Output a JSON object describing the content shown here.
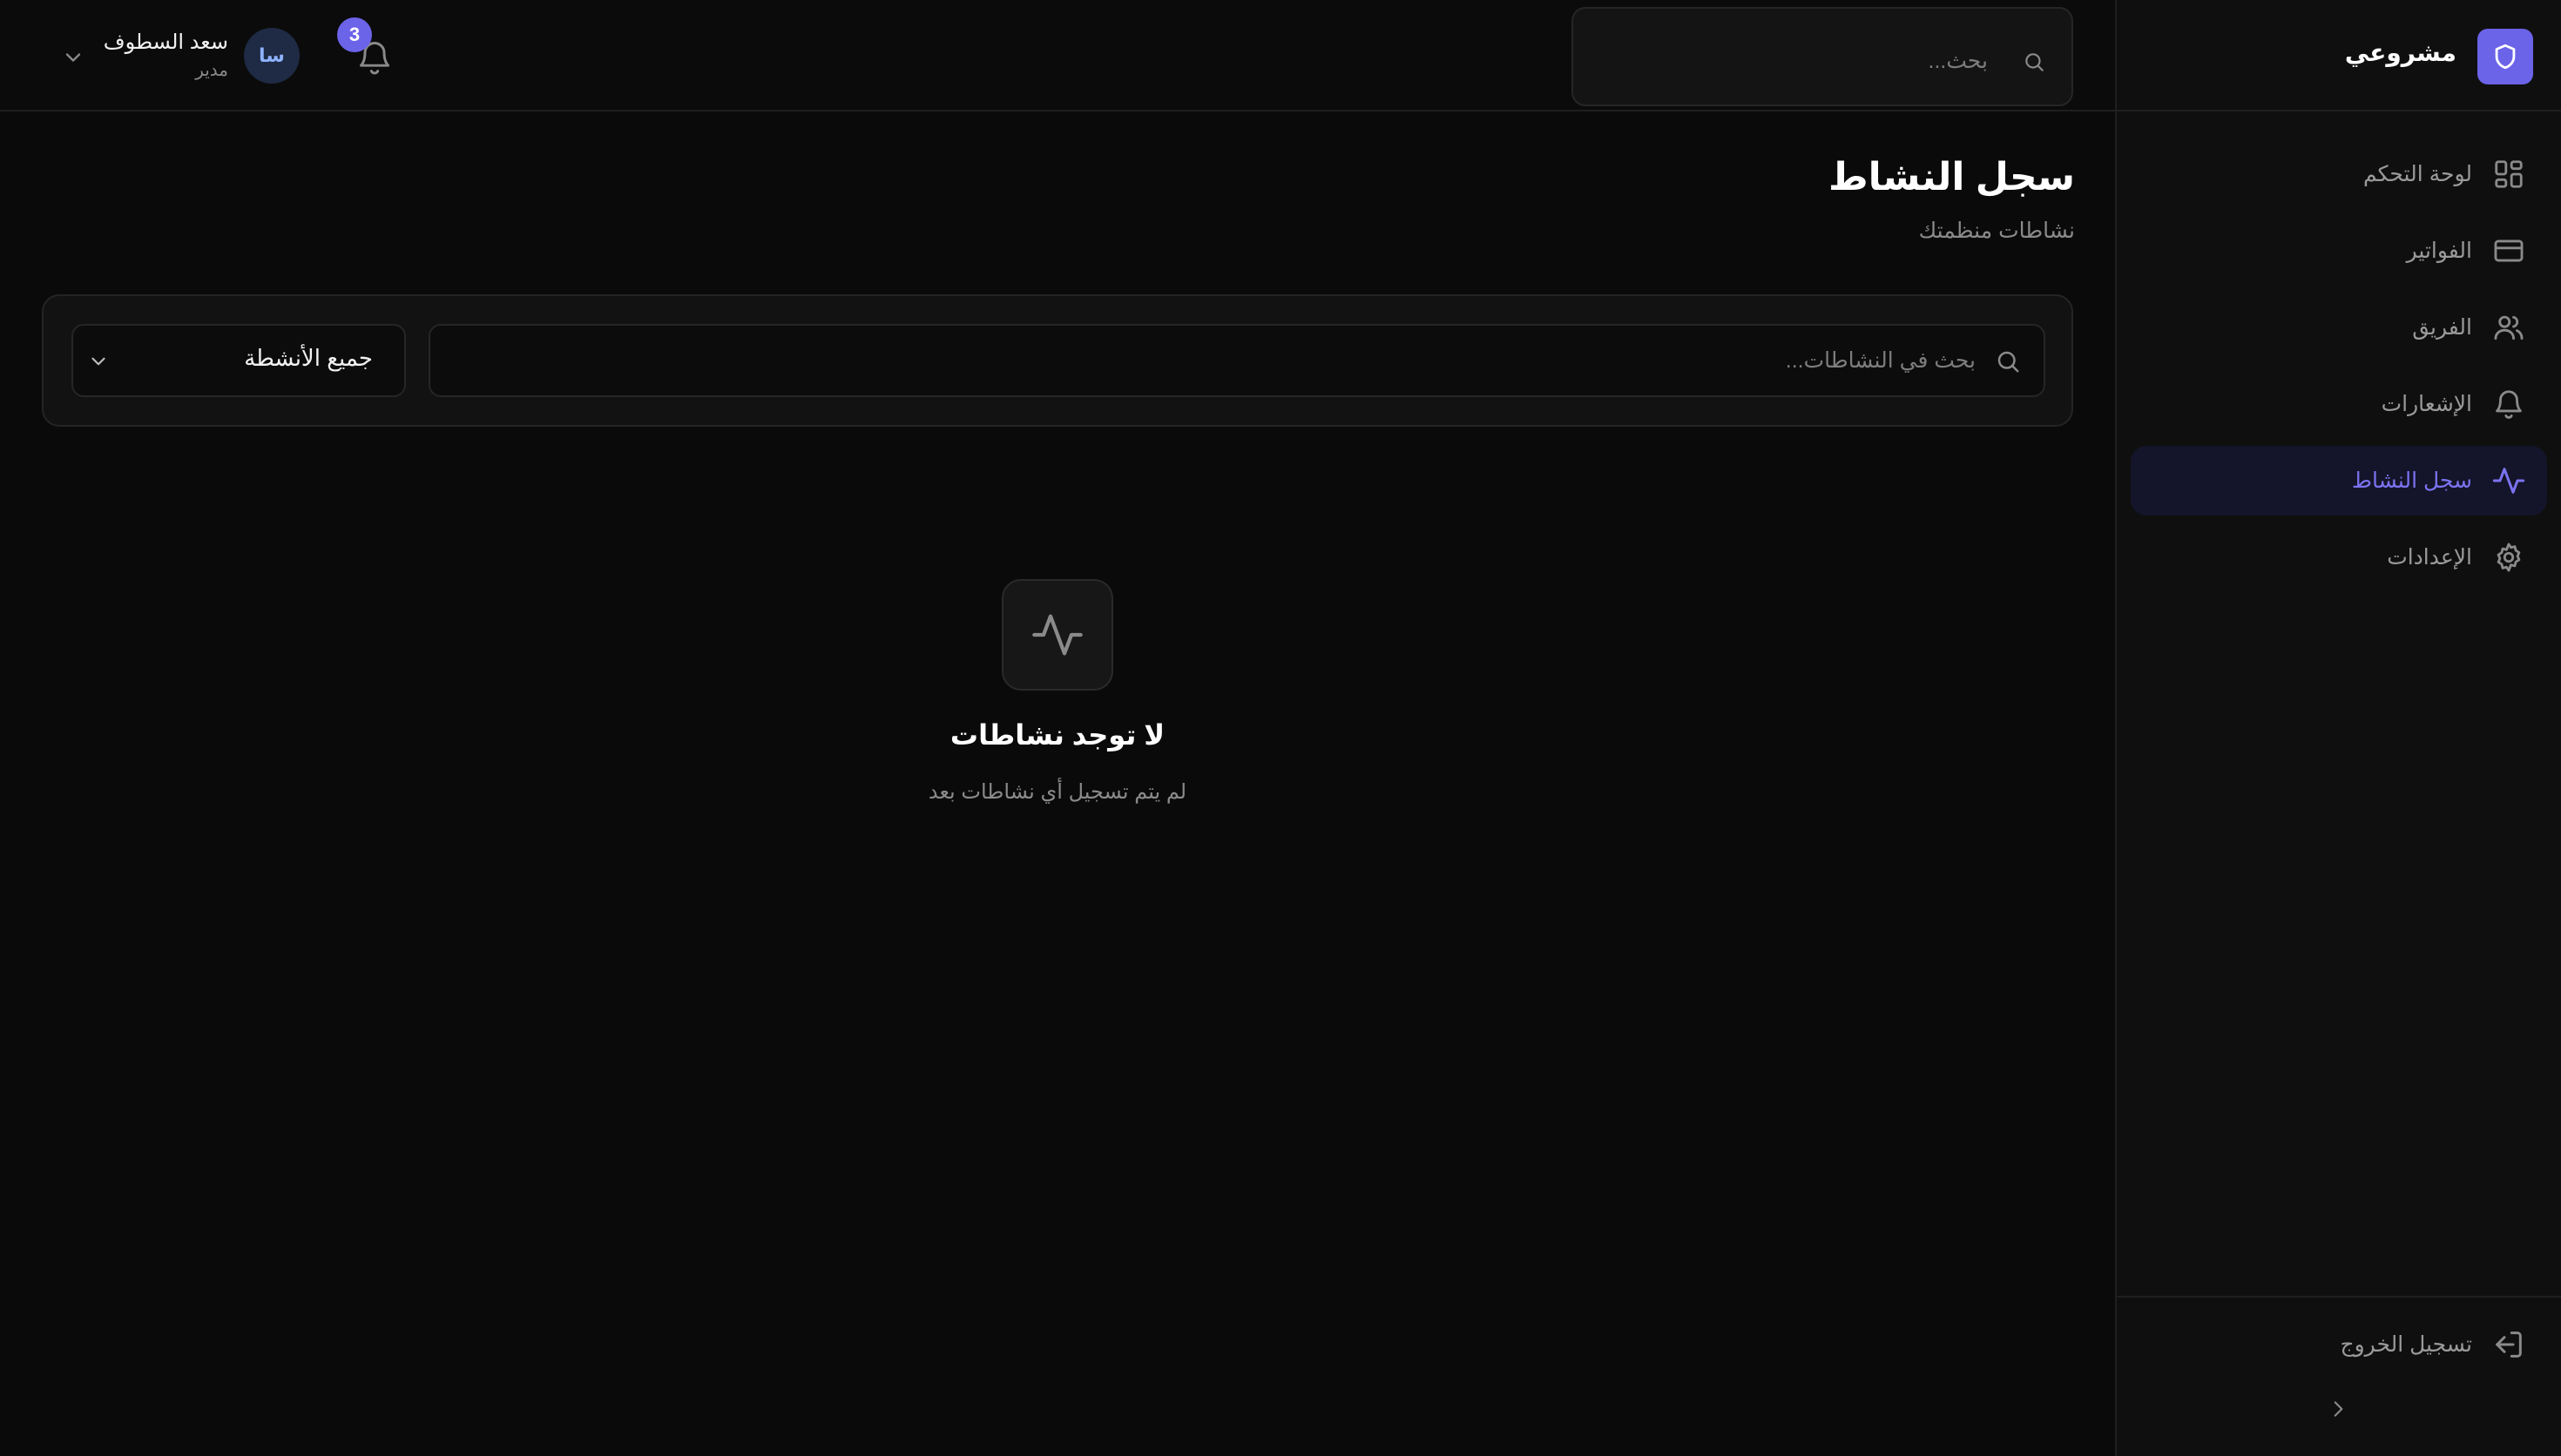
{
  "brand": {
    "name": "مشروعي",
    "logo_icon": "shield-icon",
    "accent_color": "#6b63e8"
  },
  "sidebar": {
    "items": [
      {
        "label": "لوحة التحكم",
        "icon": "dashboard-grid-icon",
        "active": false
      },
      {
        "label": "الفواتير",
        "icon": "credit-card-icon",
        "active": false
      },
      {
        "label": "الفريق",
        "icon": "users-icon",
        "active": false
      },
      {
        "label": "الإشعارات",
        "icon": "bell-icon",
        "active": false
      },
      {
        "label": "سجل النشاط",
        "icon": "activity-icon",
        "active": true
      },
      {
        "label": "الإعدادات",
        "icon": "gear-icon",
        "active": false
      }
    ],
    "logout_label": "تسجيل الخروج",
    "collapse_icon": "chevron-right-icon"
  },
  "topbar": {
    "search_placeholder": "بحث...",
    "notifications_count": "3",
    "user": {
      "initials": "سا",
      "name": "سعد السطوف",
      "role": "مدير"
    }
  },
  "page": {
    "title": "سجل النشاط",
    "subtitle": "نشاطات منظمتك",
    "filter": {
      "search_placeholder": "بحث في النشاطات...",
      "select_value": "جميع الأنشطة"
    },
    "empty_state": {
      "icon": "activity-icon",
      "title": "لا توجد نشاطات",
      "subtitle": "لم يتم تسجيل أي نشاطات بعد"
    }
  }
}
